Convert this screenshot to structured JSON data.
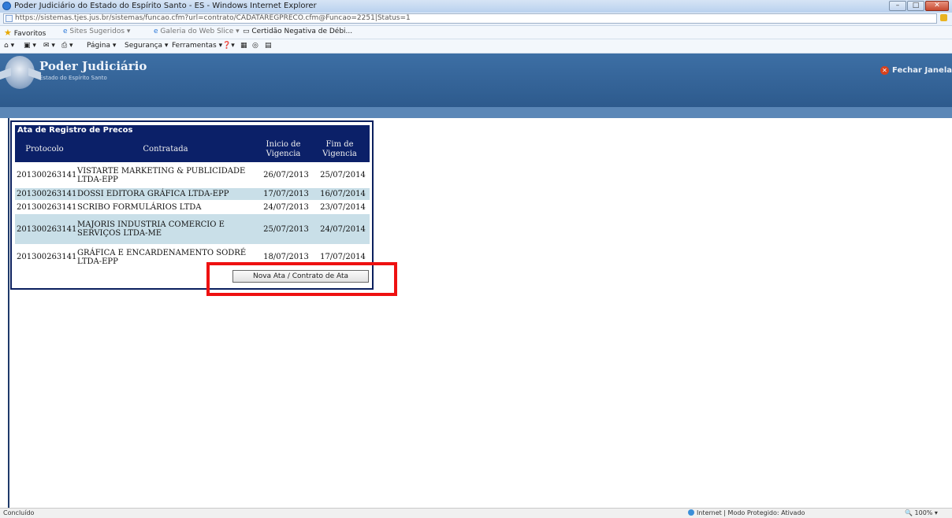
{
  "window": {
    "title": "Poder Judiciário do Estado do Espírito Santo - ES - Windows Internet Explorer",
    "url": "https://sistemas.tjes.jus.br/sistemas/funcao.cfm?url=contrato/CADATAREGPRECO.cfm@Funcao=2251|Status=1"
  },
  "favbar": {
    "favorites": "Favoritos",
    "suggested": "Sites Sugeridos ▾",
    "gallery": "Galeria do Web Slice ▾",
    "certidao": "Certidão Negativa de Débi..."
  },
  "cmdbar": {
    "pagina": "Página ▾",
    "seguranca": "Segurança ▾",
    "ferramentas": "Ferramentas ▾"
  },
  "header": {
    "title": "Poder Judiciário",
    "subtitle": "Estado do Espírito Santo",
    "close_label": "Fechar Janela"
  },
  "panel": {
    "title": "Ata de Registro de Precos",
    "columns": {
      "protocolo": "Protocolo",
      "contratada": "Contratada",
      "inicio": "Inicio de Vigencia",
      "fim": "Fim de Vigencia"
    },
    "rows": [
      {
        "protocolo": "201300263141",
        "contratada": "VISTARTE MARKETING & PUBLICIDADE LTDA-EPP",
        "inicio": "26/07/2013",
        "fim": "25/07/2014"
      },
      {
        "protocolo": "201300263141",
        "contratada": "DOSSI EDITORA GRÁFICA LTDA-EPP",
        "inicio": "17/07/2013",
        "fim": "16/07/2014"
      },
      {
        "protocolo": "201300263141",
        "contratada": "SCRIBO FORMULÁRIOS LTDA",
        "inicio": "24/07/2013",
        "fim": "23/07/2014"
      },
      {
        "protocolo": "201300263141",
        "contratada": "MAJORIS INDUSTRIA COMERCIO E SERVIÇOS LTDA-ME",
        "inicio": "25/07/2013",
        "fim": "24/07/2014"
      },
      {
        "protocolo": "201300263141",
        "contratada": "GRÁFICA E ENCARDENAMENTO SODRÉ LTDA-EPP",
        "inicio": "18/07/2013",
        "fim": "17/07/2014"
      }
    ],
    "new_button": "Nova Ata / Contrato de Ata"
  },
  "status": {
    "left": "Concluído",
    "zone": "Internet | Modo Protegido: Ativado",
    "zoom": "100%"
  }
}
